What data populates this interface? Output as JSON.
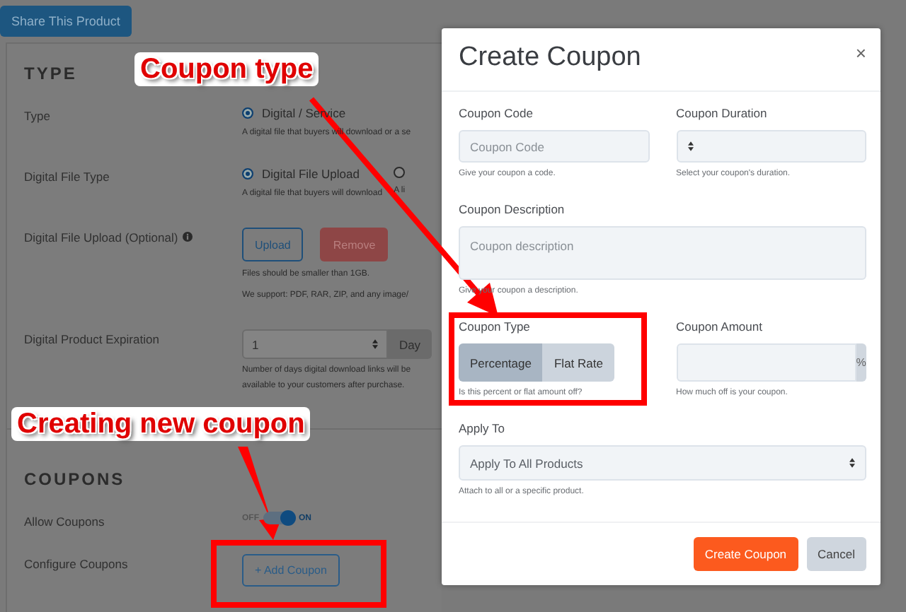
{
  "top_button": "Share This Product",
  "sections": [
    {
      "title": "TYPE",
      "rows": [
        {
          "kind": "radio",
          "label": "Type",
          "options": [
            {
              "label": "Digital / Service",
              "selected": true,
              "help": "A digital file that buyers will download or a se"
            }
          ]
        },
        {
          "kind": "radio",
          "label": "Digital File Type",
          "options": [
            {
              "label": "Digital File Upload",
              "selected": true,
              "help": "A digital file that buyers will download"
            },
            {
              "selected": false,
              "help": "A li"
            }
          ]
        },
        {
          "kind": "upload",
          "label": "Digital File Upload (Optional)",
          "buttons": [
            "Upload",
            "Remove"
          ],
          "notes": [
            "Files should be smaller than 1GB.",
            "We support: PDF, RAR, ZIP, and any image/"
          ]
        },
        {
          "kind": "number",
          "label": "Digital Product Expiration",
          "value": "1",
          "unit": "Day",
          "help": "Number of days digital download links will be available to your customers after purchase."
        }
      ]
    },
    {
      "title": "COUPONS",
      "rows": [
        {
          "kind": "toggle",
          "label": "Allow Coupons",
          "off_label": "OFF",
          "on_label": "ON",
          "on": true
        },
        {
          "kind": "button",
          "label": "Configure Coupons",
          "button": "+ Add Coupon"
        }
      ]
    }
  ],
  "modal": {
    "title": "Create Coupon",
    "close": "×",
    "rows": [
      [
        {
          "kind": "text",
          "label": "Coupon Code",
          "placeholder": "Coupon Code",
          "help": "Give your coupon a code."
        },
        {
          "kind": "select",
          "label": "Coupon Duration",
          "help": "Select your coupon's duration."
        }
      ],
      [
        {
          "kind": "textarea",
          "label": "Coupon Description",
          "placeholder": "Coupon description",
          "help": "Give your coupon a description."
        }
      ],
      [
        {
          "kind": "segmented",
          "label": "Coupon Type",
          "options": [
            {
              "label": "Percentage",
              "selected": true
            },
            {
              "label": "Flat Rate",
              "selected": false
            }
          ],
          "help": "Is this percent or flat amount off?"
        },
        {
          "kind": "addon",
          "label": "Coupon Amount",
          "addon": "%",
          "help": "How much off is your coupon."
        }
      ],
      [
        {
          "kind": "select",
          "label": "Apply To",
          "value": "Apply To All Products",
          "help": "Attach to all or a specific product."
        }
      ]
    ],
    "buttons": [
      {
        "label": "Create Coupon",
        "kind": "primary"
      },
      {
        "label": "Cancel",
        "kind": "secondary"
      }
    ]
  },
  "annotations": [
    {
      "text": "Coupon type"
    },
    {
      "text": "Creating new coupon"
    }
  ]
}
